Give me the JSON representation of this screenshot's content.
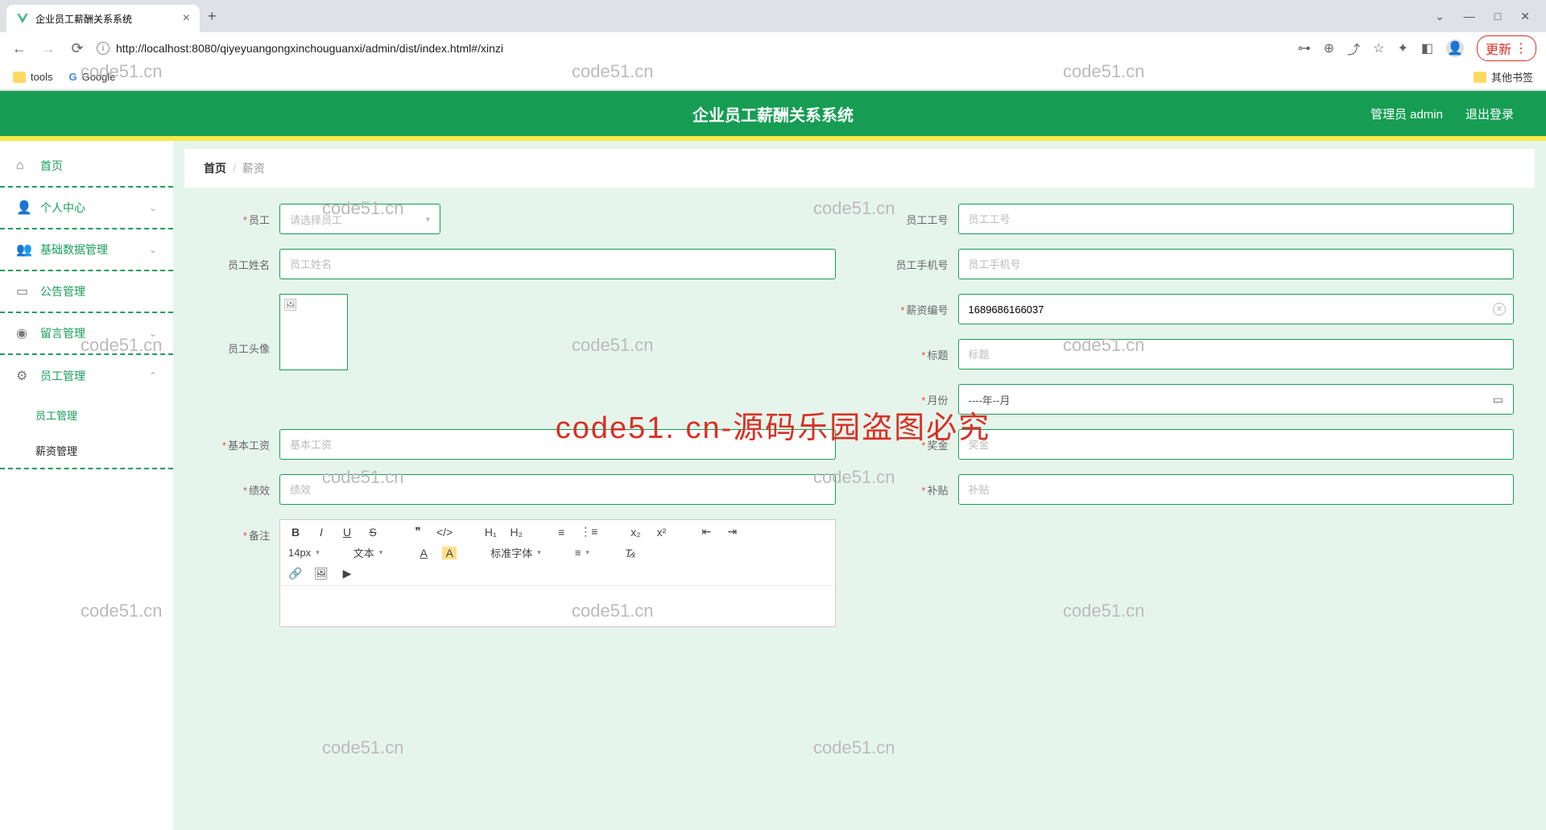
{
  "browser": {
    "tab_title": "企业员工薪酬关系系统",
    "url": "http://localhost:8080/qiyeyuangongxinchouguanxi/admin/dist/index.html#/xinzi",
    "update_label": "更新",
    "bookmarks": {
      "tools": "tools",
      "google": "Google",
      "other": "其他书签"
    }
  },
  "header": {
    "title": "企业员工薪酬关系系统",
    "user_label": "管理员 admin",
    "logout": "退出登录"
  },
  "sidebar": {
    "home": "首页",
    "personal": "个人中心",
    "basedata": "基础数据管理",
    "notice": "公告管理",
    "message": "留言管理",
    "employee": "员工管理",
    "sub_emp": "员工管理",
    "sub_salary": "薪资管理"
  },
  "breadcrumb": {
    "home": "首页",
    "current": "薪资"
  },
  "form": {
    "employee_label": "员工",
    "employee_placeholder": "请选择员工",
    "empno_label": "员工工号",
    "empno_placeholder": "员工工号",
    "empname_label": "员工姓名",
    "empname_placeholder": "员工姓名",
    "empphone_label": "员工手机号",
    "empphone_placeholder": "员工手机号",
    "avatar_label": "员工头像",
    "salaryno_label": "薪资编号",
    "salaryno_value": "1689686166037",
    "title_label": "标题",
    "title_placeholder": "标题",
    "month_label": "月份",
    "month_placeholder": "----年--月",
    "basesalary_label": "基本工资",
    "basesalary_placeholder": "基本工资",
    "bonus_label": "奖金",
    "bonus_placeholder": "奖金",
    "perf_label": "绩效",
    "perf_placeholder": "绩效",
    "allowance_label": "补贴",
    "allowance_placeholder": "补贴",
    "remark_label": "备注"
  },
  "editor": {
    "fontsize": "14px",
    "texttype": "文本",
    "fontfamily": "标准字体"
  },
  "watermark": {
    "main": "code51. cn-源码乐园盗图必究",
    "small": "code51.cn"
  }
}
